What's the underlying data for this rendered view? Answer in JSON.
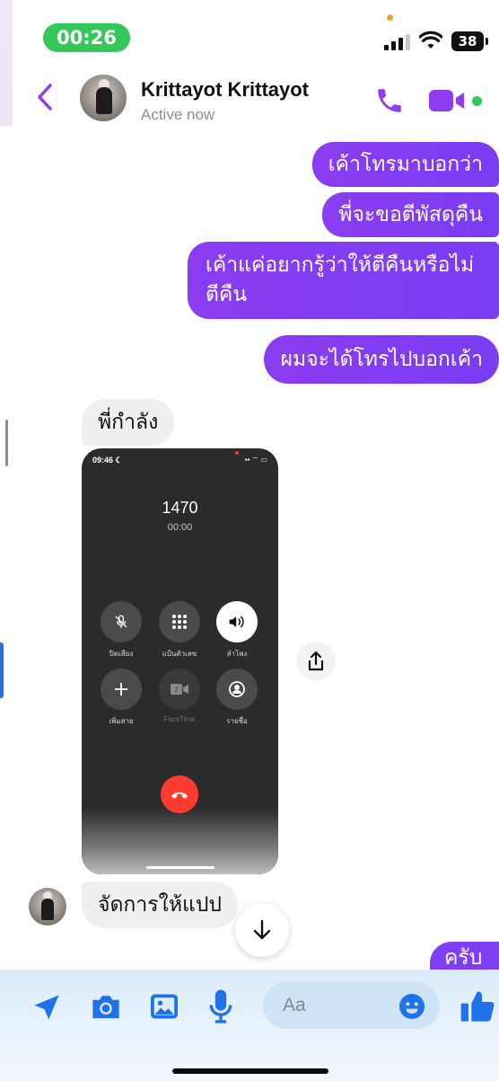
{
  "status_bar": {
    "time": "00:26",
    "battery": "38"
  },
  "header": {
    "contact_name": "Krittayot Krittayot",
    "presence": "Active now"
  },
  "messages": {
    "out1": "เค้าโทรมาบอกว่า",
    "out2": "พี่จะขอตีพัสดุคืน",
    "out3": "เค้าแค่อยากรู้ว่าให้ตีคืนหรือไม่ตีคืน",
    "out4": "ผมจะได้โทรไปบอกเค้า",
    "in1": "พี่กำลัง",
    "in2": "จัดการให้แปป",
    "out_last": "ครับ"
  },
  "call_screenshot": {
    "status_time": "09:46",
    "number": "1470",
    "duration": "00:00",
    "buttons": {
      "mute": "ปิดเสียง",
      "keypad": "แป้นตัวเลข",
      "speaker": "ลำโพง",
      "add_call": "เพิ่มสาย",
      "facetime": "FaceTime",
      "contacts": "รายชื่อ"
    }
  },
  "composer": {
    "placeholder": "Aa"
  },
  "colors": {
    "accent": "#7f3ff2",
    "online": "#34c759",
    "messenger_blue": "#1f72e8"
  }
}
